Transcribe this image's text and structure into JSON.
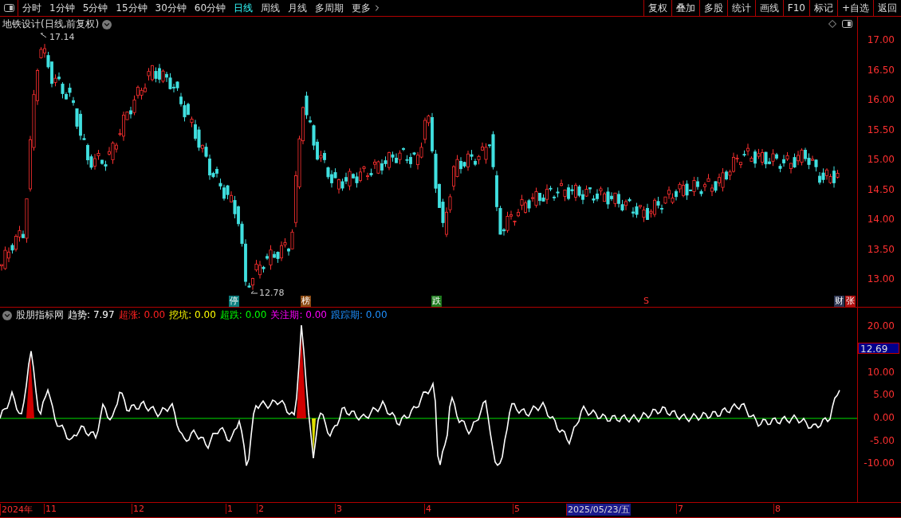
{
  "toolbar": {
    "periods": [
      {
        "label": "分时",
        "selected": false
      },
      {
        "label": "1分钟",
        "selected": false
      },
      {
        "label": "5分钟",
        "selected": false
      },
      {
        "label": "15分钟",
        "selected": false
      },
      {
        "label": "30分钟",
        "selected": false
      },
      {
        "label": "60分钟",
        "selected": false
      },
      {
        "label": "日线",
        "selected": true
      },
      {
        "label": "周线",
        "selected": false
      },
      {
        "label": "月线",
        "selected": false
      },
      {
        "label": "多周期",
        "selected": false
      },
      {
        "label": "更多",
        "selected": false
      }
    ],
    "actions": [
      "复权",
      "叠加",
      "多股",
      "统计",
      "画线",
      "F10",
      "标记",
      "+自选",
      "返回"
    ]
  },
  "main_chart": {
    "title": "地铁设计(日线,前复权)",
    "high_label": "17.14",
    "low_label": "12.78",
    "yaxis": [
      "17.00",
      "16.50",
      "16.00",
      "15.50",
      "15.00",
      "14.50",
      "14.00",
      "13.50",
      "13.00"
    ],
    "markers": [
      {
        "label": "停",
        "color": "#0b7d7d"
      },
      {
        "label": "榜",
        "color": "#8b4a12"
      },
      {
        "label": "跌",
        "color": "#1d7a1d"
      },
      {
        "label": "S",
        "color": "#000000"
      },
      {
        "label": "财",
        "color": "#2a3350"
      },
      {
        "label": "张",
        "color": "#b01010"
      }
    ]
  },
  "indicator": {
    "name": "股朋指标网",
    "current": "12.69",
    "values": [
      {
        "label": "趋势:",
        "value": "7.97",
        "color": "#ffffff"
      },
      {
        "label": "超涨:",
        "value": "0.00",
        "color": "#ff2020"
      },
      {
        "label": "挖坑:",
        "value": "0.00",
        "color": "#ffff00"
      },
      {
        "label": "超跌:",
        "value": "0.00",
        "color": "#00ff00"
      },
      {
        "label": "关注期:",
        "value": "0.00",
        "color": "#ff00ff"
      },
      {
        "label": "跟踪期:",
        "value": "0.00",
        "color": "#1e90ff"
      }
    ],
    "yaxis": [
      "20.00",
      "10.00",
      "5.00",
      "0.00",
      "-5.00",
      "-10.00"
    ]
  },
  "time_axis": [
    {
      "label": "2024年",
      "selected": false
    },
    {
      "label": "11",
      "selected": false
    },
    {
      "label": "12",
      "selected": false
    },
    {
      "label": "1",
      "selected": false
    },
    {
      "label": "2",
      "selected": false
    },
    {
      "label": "3",
      "selected": false
    },
    {
      "label": "4",
      "selected": false
    },
    {
      "label": "5",
      "selected": false
    },
    {
      "label": "2025/05/23/五",
      "selected": true
    },
    {
      "label": "7",
      "selected": false
    },
    {
      "label": "8",
      "selected": false
    }
  ]
}
